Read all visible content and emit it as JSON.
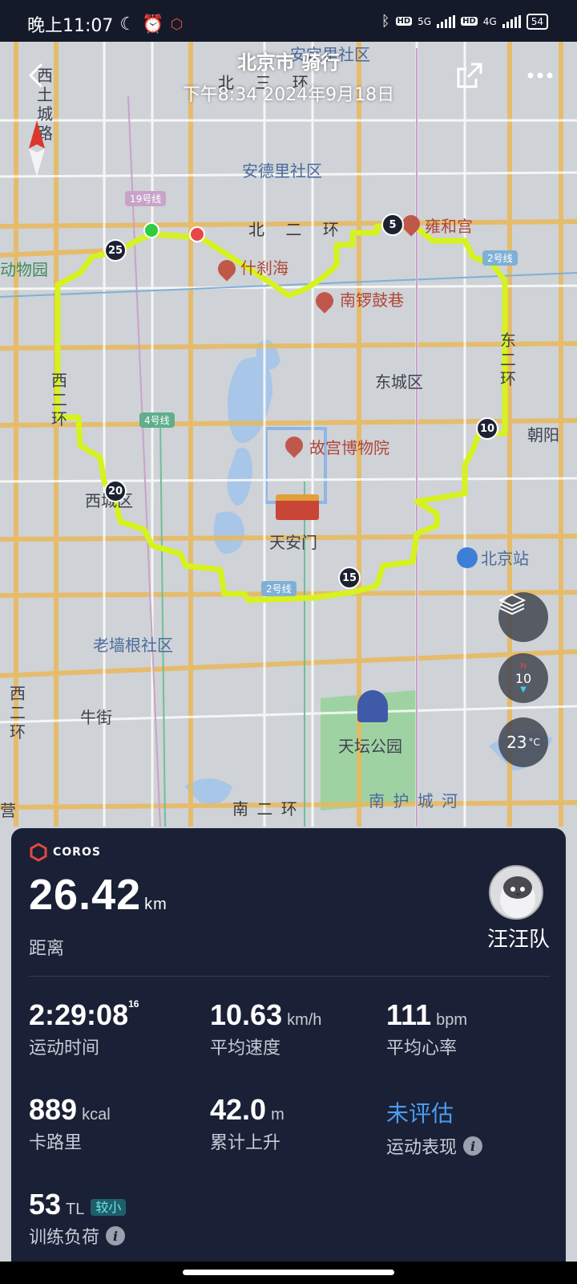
{
  "status_bar": {
    "time": "晚上11:07",
    "net1": "5G",
    "net2": "4G",
    "hd": "HD",
    "battery": "54"
  },
  "header": {
    "title": "北京市 骑行",
    "subtitle": "下午8:34 2024年9月18日"
  },
  "map": {
    "labels": {
      "anding": "安德里社区",
      "andingtop": "安定里社区",
      "beierhuan": "北 二 环",
      "beisanhuan": "北 三 环",
      "shichahai": "什刹海",
      "nanluoguxiang": "南锣鼓巷",
      "yonghegong": "雍和宫",
      "dongchengqu": "东城区",
      "gugong": "故宫博物院",
      "tiananmen": "天安门",
      "xichengqu": "西城区",
      "beijingzhan": "北京站",
      "laoqianggen": "老墙根社区",
      "niujie": "牛街",
      "tiantan": "天坛公园",
      "nanhuchenghe": "南 护 城 河",
      "nanerhuan": "南 二 环",
      "chaoyang": "朝阳",
      "dongwuyuan": "动物园",
      "ying": "营",
      "xierhuan": "西二环",
      "xierhuan2": "西二环",
      "dongerhuan": "东二环",
      "xitucheng": "西土城路"
    },
    "lines": {
      "l19": "19号线",
      "l2": "2号线",
      "l4": "4号线",
      "l2b": "2号线"
    },
    "km_markers": [
      "5",
      "10",
      "15",
      "20",
      "25"
    ],
    "compass_value": "10",
    "temperature": "23",
    "temperature_unit": "°C"
  },
  "stats": {
    "brand": "COROS",
    "distance_value": "26.42",
    "distance_unit": "km",
    "distance_label": "距离",
    "user_name": "汪汪队",
    "duration_value": "2:29:08",
    "duration_sub": "16",
    "duration_label": "运动时间",
    "speed_value": "10.63",
    "speed_unit": "km/h",
    "speed_label": "平均速度",
    "hr_value": "111",
    "hr_unit": "bpm",
    "hr_label": "平均心率",
    "cal_value": "889",
    "cal_unit": "kcal",
    "cal_label": "卡路里",
    "ascent_value": "42.0",
    "ascent_unit": "m",
    "ascent_label": "累计上升",
    "perf_value": "未评估",
    "perf_label": "运动表现",
    "tl_value": "53",
    "tl_unit": "TL",
    "tl_badge": "较小",
    "tl_label": "训练负荷"
  },
  "colors": {
    "route": "#d6f21f",
    "panel": "#1a2035",
    "accent_blue": "#4a9cf5",
    "start": "#2ecc40",
    "end": "#e8474a"
  }
}
